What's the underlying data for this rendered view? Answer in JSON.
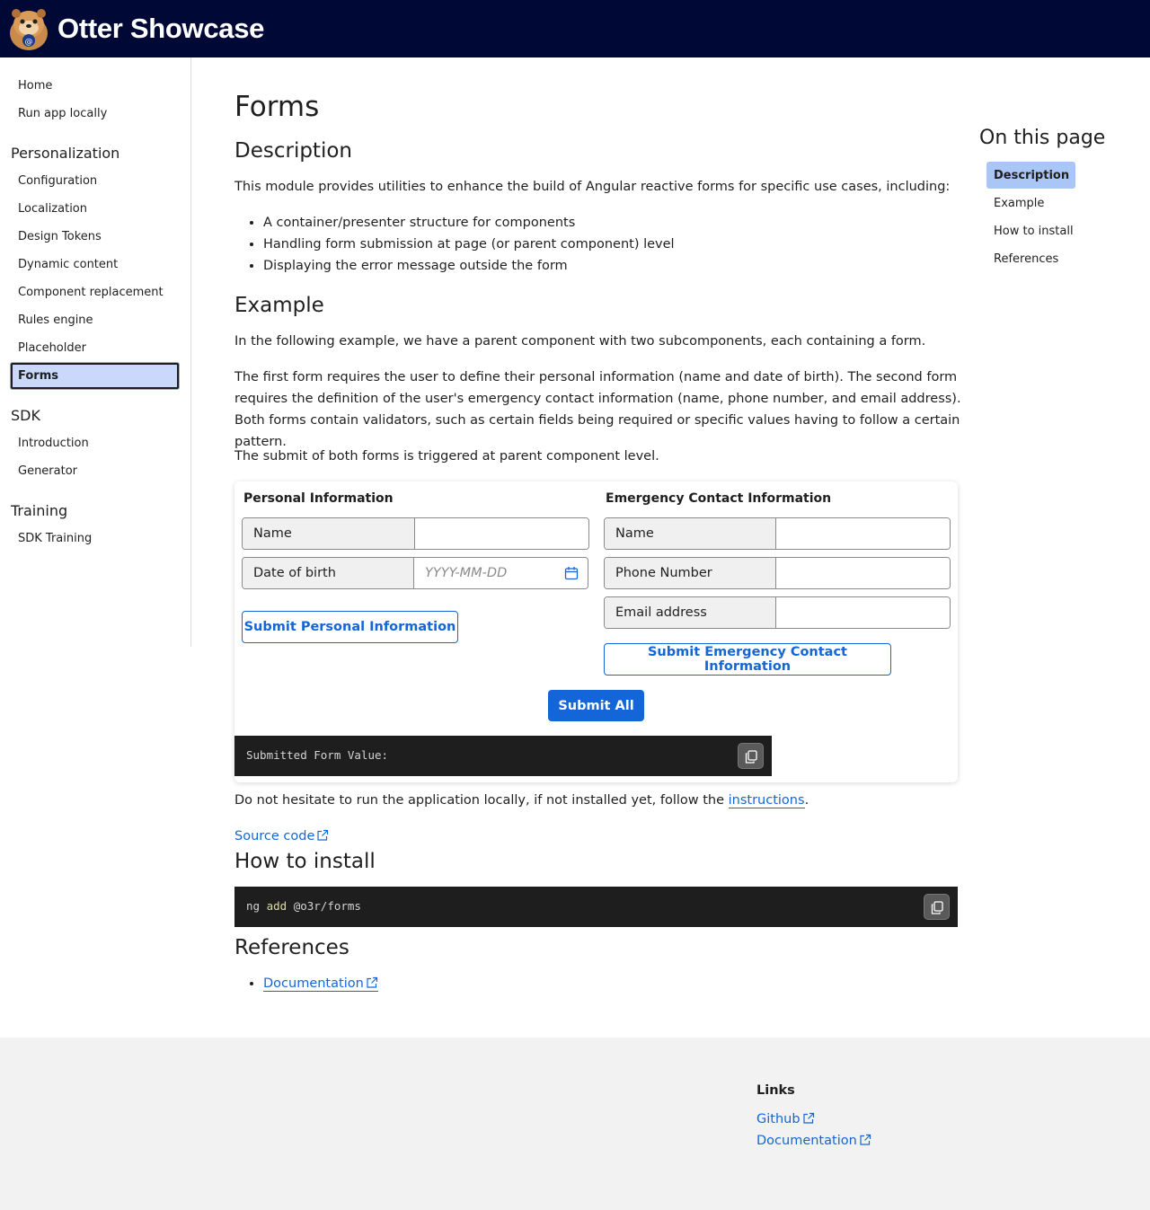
{
  "header": {
    "brand": "Otter Showcase"
  },
  "sidebar": {
    "top_items": [
      "Home",
      "Run app locally"
    ],
    "groups": [
      {
        "label": "Personalization",
        "items": [
          "Configuration",
          "Localization",
          "Design Tokens",
          "Dynamic content",
          "Component replacement",
          "Rules engine",
          "Placeholder",
          "Forms"
        ]
      },
      {
        "label": "SDK",
        "items": [
          "Introduction",
          "Generator"
        ]
      },
      {
        "label": "Training",
        "items": [
          "SDK Training"
        ]
      }
    ],
    "active_item": "Forms"
  },
  "main": {
    "title": "Forms",
    "description": {
      "heading": "Description",
      "intro": "This module provides utilities to enhance the build of Angular reactive forms for specific use cases, including:",
      "bullets": [
        "A container/presenter structure for components",
        "Handling form submission at page (or parent component) level",
        "Displaying the error message outside the form"
      ]
    },
    "example": {
      "heading": "Example",
      "p1": "In the following example, we have a parent component with two subcomponents, each containing a form.",
      "p2": "The first form requires the user to define their personal information (name and date of birth). The second form requires the definition of the user's emergency contact information (name, phone number, and email address). Both forms contain validators, such as certain fields being required or specific values having to follow a certain pattern.",
      "p3": "The submit of both forms is triggered at parent component level."
    },
    "form_card": {
      "personal": {
        "title": "Personal Information",
        "name_label": "Name",
        "name_value": "",
        "dob_label": "Date of birth",
        "dob_placeholder": "YYYY-MM-DD",
        "submit": "Submit Personal Information"
      },
      "emergency": {
        "title": "Emergency Contact Information",
        "name_label": "Name",
        "phone_label": "Phone Number",
        "email_label": "Email address",
        "submit": "Submit Emergency Contact Information"
      },
      "submit_all": "Submit All",
      "output": "Submitted Form Value:"
    },
    "run_locally": {
      "prefix": "Do not hesitate to run the application locally, if not installed yet, follow the ",
      "link": "instructions",
      "suffix": "."
    },
    "source_code": "Source code",
    "install": {
      "heading": "How to install",
      "cmd_prefix": "ng",
      "cmd_keyword": "add",
      "cmd_arg": "@o3r/forms"
    },
    "references": {
      "heading": "References",
      "items": [
        "Documentation"
      ]
    }
  },
  "toc": {
    "title": "On this page",
    "items": [
      "Description",
      "Example",
      "How to install",
      "References"
    ],
    "active": "Description"
  },
  "footer": {
    "title": "Links",
    "links": [
      "Github",
      "Documentation"
    ]
  },
  "colors": {
    "header_bg": "#000835",
    "accent": "#1466d8",
    "nav_active": "#c9d8fb",
    "toc_active": "#a9c6f7"
  }
}
